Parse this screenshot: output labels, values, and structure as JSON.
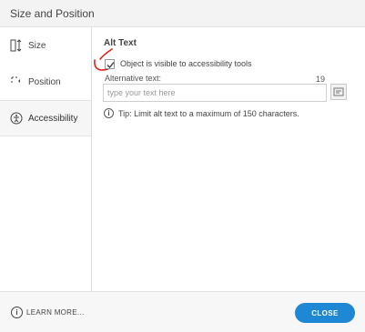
{
  "window": {
    "title": "Size and Position"
  },
  "sidebar": {
    "items": [
      {
        "label": "Size",
        "icon": "resize-vertical-icon",
        "active": false
      },
      {
        "label": "Position",
        "icon": "position-icon",
        "active": false
      },
      {
        "label": "Accessibility",
        "icon": "accessibility-icon",
        "active": true
      }
    ]
  },
  "accessibility": {
    "section_title": "Alt Text",
    "visible_checkbox": {
      "label": "Object is visible to accessibility tools",
      "checked": true
    },
    "alt_text": {
      "label": "Alternative text:",
      "count": "19",
      "value": "",
      "placeholder": "type your text here"
    },
    "tip": "Tip: Limit alt text to a maximum of 150 characters."
  },
  "footer": {
    "learn_more": "LEARN MORE...",
    "close": "CLOSE"
  },
  "colors": {
    "accent": "#1e88d5",
    "annotation": "#e0201a"
  }
}
